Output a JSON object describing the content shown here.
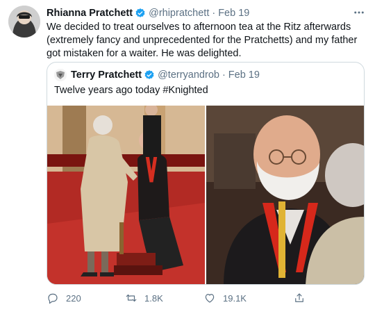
{
  "tweet": {
    "display_name": "Rhianna Pratchett",
    "handle": "@rhipratchett",
    "separator": "·",
    "date": "Feb 19",
    "more_icon": "more-horizontal-icon",
    "text": "We decided to treat ourselves to afternoon tea at the Ritz afterwards (extremely fancy and unprecedented for the Pratchetts) and my father got mistaken for a waiter. He was delighted.",
    "verified_color": "#1da1f2"
  },
  "quoted": {
    "display_name": "Terry Pratchett",
    "handle": "@terryandrob",
    "separator": "·",
    "date": "Feb 19",
    "text": "Twelve years ago today #Knighted"
  },
  "actions": {
    "reply_count": "220",
    "retweet_count": "1.8K",
    "like_count": "19.1K",
    "reply_icon": "reply-icon",
    "retweet_icon": "retweet-icon",
    "like_icon": "heart-icon",
    "share_icon": "share-icon"
  },
  "colors": {
    "text": "#0f1419",
    "muted": "#5b7083",
    "border": "#cfd9de",
    "accent": "#1da1f2"
  }
}
